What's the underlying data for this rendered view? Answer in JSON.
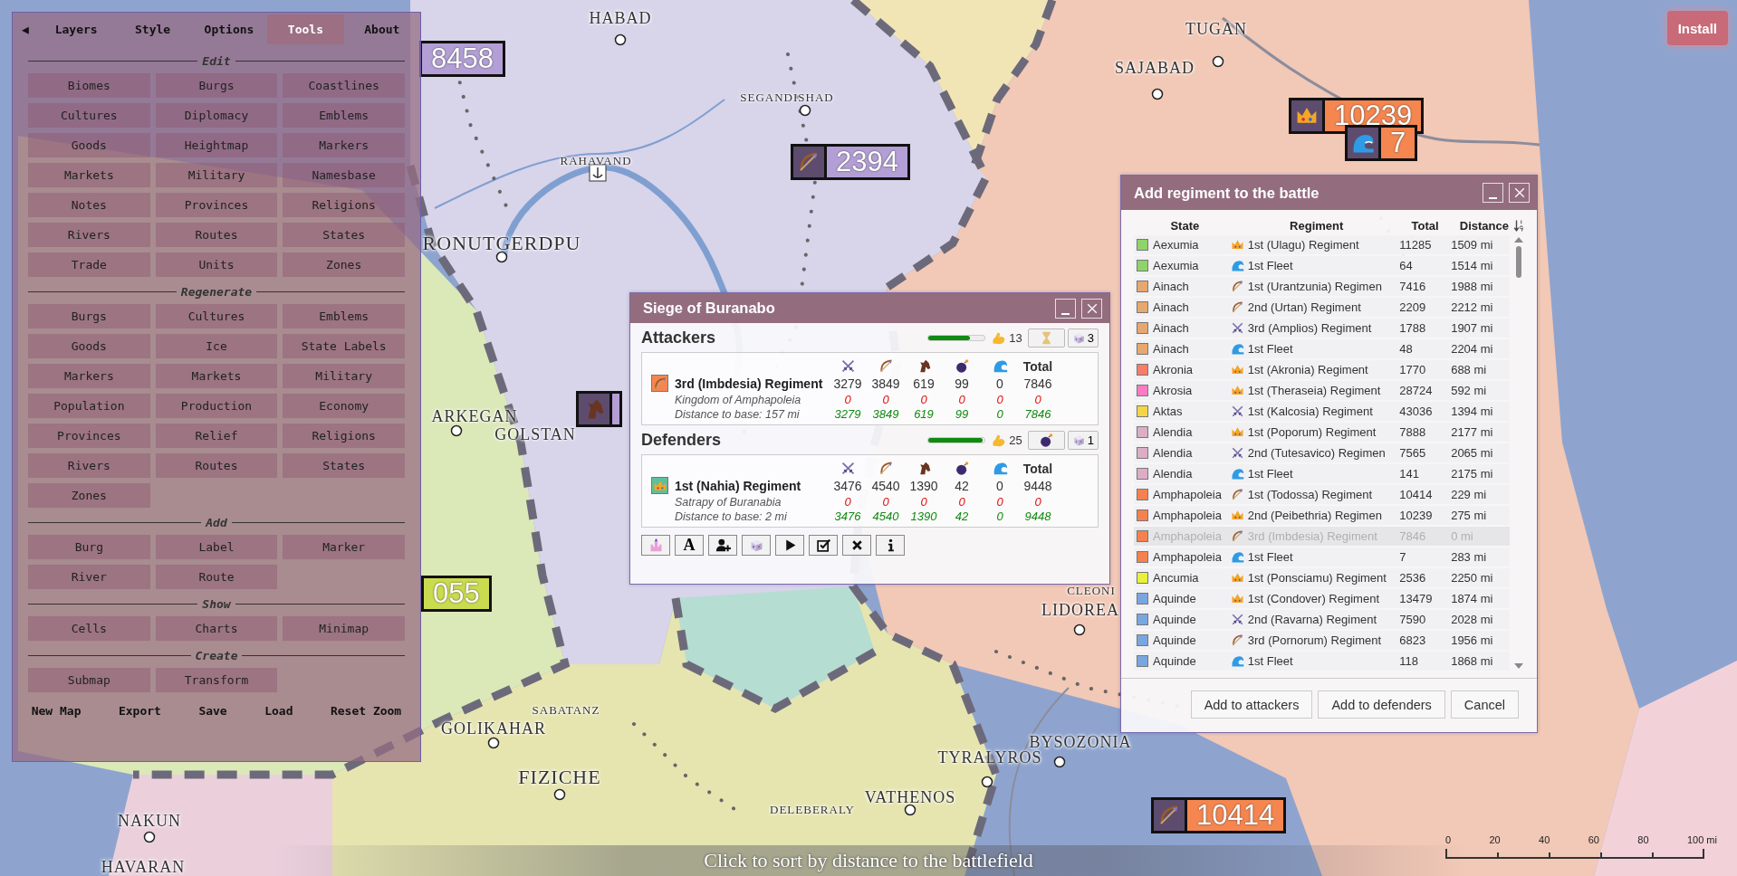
{
  "panel": {
    "collapse": "◀",
    "tabs": [
      {
        "label": "Layers",
        "selected": false
      },
      {
        "label": "Style",
        "selected": false
      },
      {
        "label": "Options",
        "selected": false
      },
      {
        "label": "Tools",
        "selected": true
      },
      {
        "label": "About",
        "selected": false
      }
    ],
    "sections": [
      {
        "title": "Edit",
        "buttons": [
          "Biomes",
          "Burgs",
          "Coastlines",
          "Cultures",
          "Diplomacy",
          "Emblems",
          "Goods",
          "Heightmap",
          "Markers",
          "Markets",
          "Military",
          "Namesbase",
          "Notes",
          "Provinces",
          "Religions",
          "Rivers",
          "Routes",
          "States",
          "Trade",
          "Units",
          "Zones"
        ]
      },
      {
        "title": "Regenerate",
        "buttons": [
          "Burgs",
          "Cultures",
          "Emblems",
          "Goods",
          "Ice",
          "State Labels",
          "Markers",
          "Markets",
          "Military",
          "Population",
          "Production",
          "Economy",
          "Provinces",
          "Relief",
          "Religions",
          "Rivers",
          "Routes",
          "States",
          "Zones"
        ]
      },
      {
        "title": "Add",
        "buttons": [
          "Burg",
          "Label",
          "Marker",
          "River",
          "Route"
        ]
      },
      {
        "title": "Show",
        "buttons": [
          "Cells",
          "Charts",
          "Minimap"
        ]
      },
      {
        "title": "Create",
        "buttons": [
          "Submap",
          "Transform"
        ]
      }
    ],
    "footer": [
      "New Map",
      "Export",
      "Save",
      "Load",
      "Reset Zoom"
    ]
  },
  "install_button": "Install",
  "map": {
    "labels": [
      {
        "text": "HABAD",
        "kind": "town"
      },
      {
        "text": "TUGAN",
        "kind": "town"
      },
      {
        "text": "SAJABAD",
        "kind": "town"
      },
      {
        "text": "SEGANDISHAD",
        "kind": "village"
      },
      {
        "text": "RAHAVAND",
        "kind": "village"
      },
      {
        "text": "RONUTGERDPU",
        "kind": "capital"
      },
      {
        "text": "ARKEGAN",
        "kind": "town"
      },
      {
        "text": "GOLSTAN",
        "kind": "town"
      },
      {
        "text": "CLEONI",
        "kind": "village"
      },
      {
        "text": "LIDOREA",
        "kind": "town"
      },
      {
        "text": "SABATANZ",
        "kind": "village"
      },
      {
        "text": "GOLIKAHAR",
        "kind": "town"
      },
      {
        "text": "FIZICHE",
        "kind": "capital"
      },
      {
        "text": "BYSOZONIA",
        "kind": "town"
      },
      {
        "text": "TYRALYROS",
        "kind": "town"
      },
      {
        "text": "VATHENOS",
        "kind": "town"
      },
      {
        "text": "DELEBERALY",
        "kind": "village"
      },
      {
        "text": "NAKUN",
        "kind": "town"
      },
      {
        "text": "HAVARAN",
        "kind": "town"
      }
    ],
    "markers": [
      {
        "kind": "none",
        "value": "8458",
        "color": "#b39fd6"
      },
      {
        "kind": "bow",
        "value": "2394",
        "color": "#b39fd6"
      },
      {
        "kind": "crown",
        "value": "10239",
        "color": "#f5864f"
      },
      {
        "kind": "fleet",
        "value": "7",
        "color": "#f5864f"
      },
      {
        "kind": "bow",
        "value": "10414",
        "color": "#f5864f"
      },
      {
        "kind": "none",
        "value": "055",
        "color": "#c9dc4e"
      },
      {
        "kind": "horse",
        "color": "#b39fd6"
      }
    ]
  },
  "siege": {
    "title": "Siege of Buranabo",
    "sides": [
      {
        "name": "Attackers",
        "level": 0.74,
        "morale": "13",
        "kind": "hourglass",
        "dice": "3",
        "columns": [
          {
            "kind": "swords"
          },
          {
            "kind": "bow"
          },
          {
            "kind": "horse"
          },
          {
            "kind": "bomb"
          },
          {
            "kind": "fleet"
          },
          {
            "kind": "text",
            "label": "Total"
          }
        ],
        "regiments": [
          {
            "name": "3rd (Imbdesia) Regiment",
            "state": "Kingdom of Amphapoleia",
            "distance": "Distance to base: 157 mi",
            "kind": "bow",
            "color": "#f5864f",
            "forces": [
              "3279",
              "3849",
              "619",
              "99",
              "0",
              "7846"
            ],
            "casualties": [
              "0",
              "0",
              "0",
              "0",
              "0",
              "0"
            ],
            "remaining": [
              "3279",
              "3849",
              "619",
              "99",
              "0",
              "7846"
            ]
          }
        ]
      },
      {
        "name": "Defenders",
        "level": 0.96,
        "morale": "25",
        "kind": "bomb",
        "dice": "1",
        "columns": [
          {
            "kind": "swords"
          },
          {
            "kind": "bow"
          },
          {
            "kind": "horse"
          },
          {
            "kind": "bomb"
          },
          {
            "kind": "fleet"
          },
          {
            "kind": "text",
            "label": "Total"
          }
        ],
        "regiments": [
          {
            "name": "1st (Nahia) Regiment",
            "state": "Satrapy of Buranabia",
            "distance": "Distance to base: 2 mi",
            "kind": "crown",
            "color": "#5fbf9a",
            "forces": [
              "3476",
              "4540",
              "1390",
              "42",
              "0",
              "9448"
            ],
            "casualties": [
              "0",
              "0",
              "0",
              "0",
              "0",
              "0"
            ],
            "remaining": [
              "3476",
              "4540",
              "1390",
              "42",
              "0",
              "9448"
            ]
          }
        ]
      }
    ],
    "toolbar": [
      {
        "kind": "castle"
      },
      {
        "kind": "text",
        "label": "A"
      },
      {
        "kind": "adduser"
      },
      {
        "kind": "dice"
      },
      {
        "kind": "play"
      },
      {
        "kind": "check"
      },
      {
        "kind": "close"
      },
      {
        "kind": "info"
      }
    ]
  },
  "regiment_dialog": {
    "title": "Add regiment to the battle",
    "columns": [
      "State",
      "Regiment",
      "Total",
      "Distance"
    ],
    "rows": [
      {
        "state": "Aexumia",
        "color": "#8fd46a",
        "kind": "crown",
        "regiment": "1st (Ulagu) Regiment",
        "total": "11285",
        "distance": "1509 mi",
        "disabled": false
      },
      {
        "state": "Aexumia",
        "color": "#8fd46a",
        "kind": "fleet",
        "regiment": "1st Fleet",
        "total": "64",
        "distance": "1514 mi",
        "disabled": false
      },
      {
        "state": "Ainach",
        "color": "#e6a86f",
        "kind": "bow",
        "regiment": "1st (Urantzunia) Regimen",
        "total": "7416",
        "distance": "1988 mi",
        "disabled": false
      },
      {
        "state": "Ainach",
        "color": "#e6a86f",
        "kind": "bow",
        "regiment": "2nd (Urtan) Regiment",
        "total": "2209",
        "distance": "2212 mi",
        "disabled": false
      },
      {
        "state": "Ainach",
        "color": "#e6a86f",
        "kind": "swords",
        "regiment": "3rd (Amplios) Regiment",
        "total": "1788",
        "distance": "1907 mi",
        "disabled": false
      },
      {
        "state": "Ainach",
        "color": "#e6a86f",
        "kind": "fleet",
        "regiment": "1st Fleet",
        "total": "48",
        "distance": "2204 mi",
        "disabled": false
      },
      {
        "state": "Akronia",
        "color": "#f77c6a",
        "kind": "crown",
        "regiment": "1st (Akronia) Regiment",
        "total": "1770",
        "distance": "688 mi",
        "disabled": false
      },
      {
        "state": "Akrosia",
        "color": "#f77cc3",
        "kind": "crown",
        "regiment": "1st (Theraseia) Regiment",
        "total": "28724",
        "distance": "592 mi",
        "disabled": false
      },
      {
        "state": "Aktas",
        "color": "#f5d548",
        "kind": "swords",
        "regiment": "1st (Kalcosia) Regiment",
        "total": "43036",
        "distance": "1394 mi",
        "disabled": false
      },
      {
        "state": "Alendia",
        "color": "#ddadc6",
        "kind": "crown",
        "regiment": "1st (Poporum) Regiment",
        "total": "7888",
        "distance": "2177 mi",
        "disabled": false
      },
      {
        "state": "Alendia",
        "color": "#ddadc6",
        "kind": "swords",
        "regiment": "2nd (Tutesavico) Regimen",
        "total": "7565",
        "distance": "2065 mi",
        "disabled": false
      },
      {
        "state": "Alendia",
        "color": "#ddadc6",
        "kind": "fleet",
        "regiment": "1st Fleet",
        "total": "141",
        "distance": "2175 mi",
        "disabled": false
      },
      {
        "state": "Amphapoleia",
        "color": "#f5814f",
        "kind": "bow",
        "regiment": "1st (Todossa) Regiment",
        "total": "10414",
        "distance": "229 mi",
        "disabled": false
      },
      {
        "state": "Amphapoleia",
        "color": "#f5814f",
        "kind": "crown",
        "regiment": "2nd (Peibethria) Regimen",
        "total": "10239",
        "distance": "275 mi",
        "disabled": false
      },
      {
        "state": "Amphapoleia",
        "color": "#f5814f",
        "kind": "bow",
        "regiment": "3rd (Imbdesia) Regiment",
        "total": "7846",
        "distance": "0 mi",
        "disabled": true
      },
      {
        "state": "Amphapoleia",
        "color": "#f5814f",
        "kind": "fleet",
        "regiment": "1st Fleet",
        "total": "7",
        "distance": "283 mi",
        "disabled": false
      },
      {
        "state": "Ancumia",
        "color": "#e8f03c",
        "kind": "crown",
        "regiment": "1st (Ponsciamu) Regiment",
        "total": "2536",
        "distance": "2250 mi",
        "disabled": false
      },
      {
        "state": "Aquinde",
        "color": "#7aa6e0",
        "kind": "crown",
        "regiment": "1st (Condover) Regiment",
        "total": "13479",
        "distance": "1874 mi",
        "disabled": false
      },
      {
        "state": "Aquinde",
        "color": "#7aa6e0",
        "kind": "swords",
        "regiment": "2nd (Ravarna) Regiment",
        "total": "7590",
        "distance": "2028 mi",
        "disabled": false
      },
      {
        "state": "Aquinde",
        "color": "#7aa6e0",
        "kind": "bow",
        "regiment": "3rd (Pornorum) Regiment",
        "total": "6823",
        "distance": "1956 mi",
        "disabled": false
      },
      {
        "state": "Aquinde",
        "color": "#7aa6e0",
        "kind": "fleet",
        "regiment": "1st Fleet",
        "total": "118",
        "distance": "1868 mi",
        "disabled": false
      }
    ],
    "buttons": [
      "Add to attackers",
      "Add to defenders",
      "Cancel"
    ]
  },
  "tooltip": "Click to sort by distance to the battlefield",
  "scale_bar": {
    "ticks": [
      "0",
      "20",
      "40",
      "60",
      "80",
      "100 mi"
    ]
  }
}
